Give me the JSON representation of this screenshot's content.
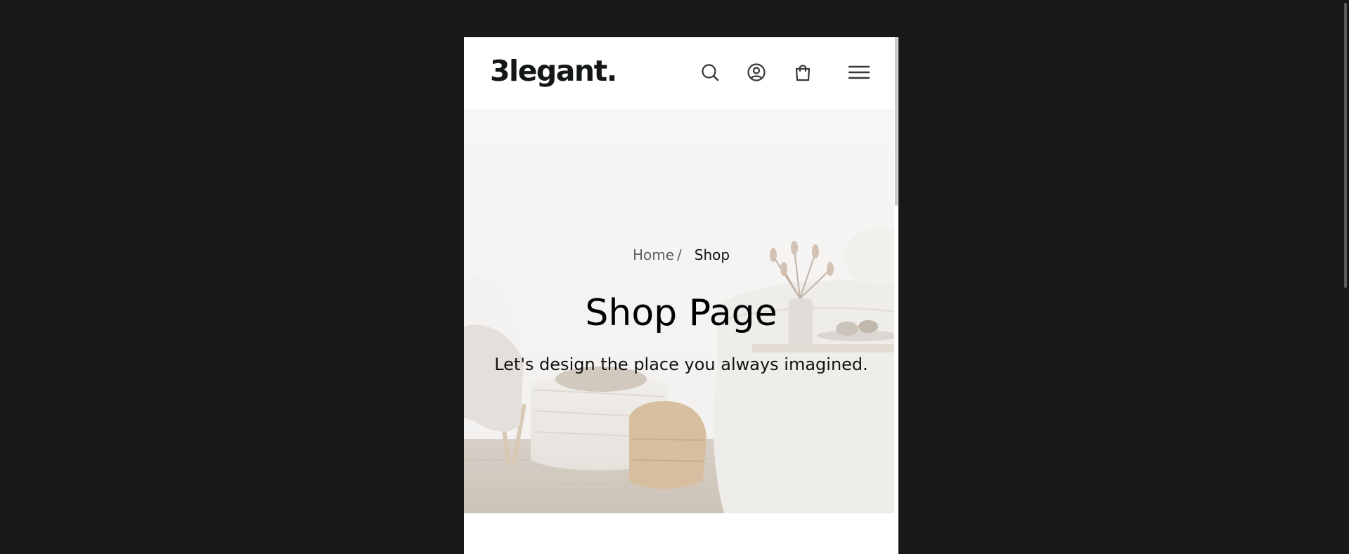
{
  "header": {
    "logo": "3legant.",
    "icons": [
      "search-icon",
      "user-icon",
      "shopping-bag-icon",
      "menu-icon"
    ]
  },
  "hero": {
    "breadcrumb": {
      "home": "Home",
      "separator": "/",
      "current": "Shop"
    },
    "title": "Shop Page",
    "subtitle": "Let's design the place you always imagined."
  },
  "colors": {
    "page_background": "#18181b",
    "text_primary": "#141718",
    "text_muted": "#605f5f",
    "icon": "#343839"
  }
}
